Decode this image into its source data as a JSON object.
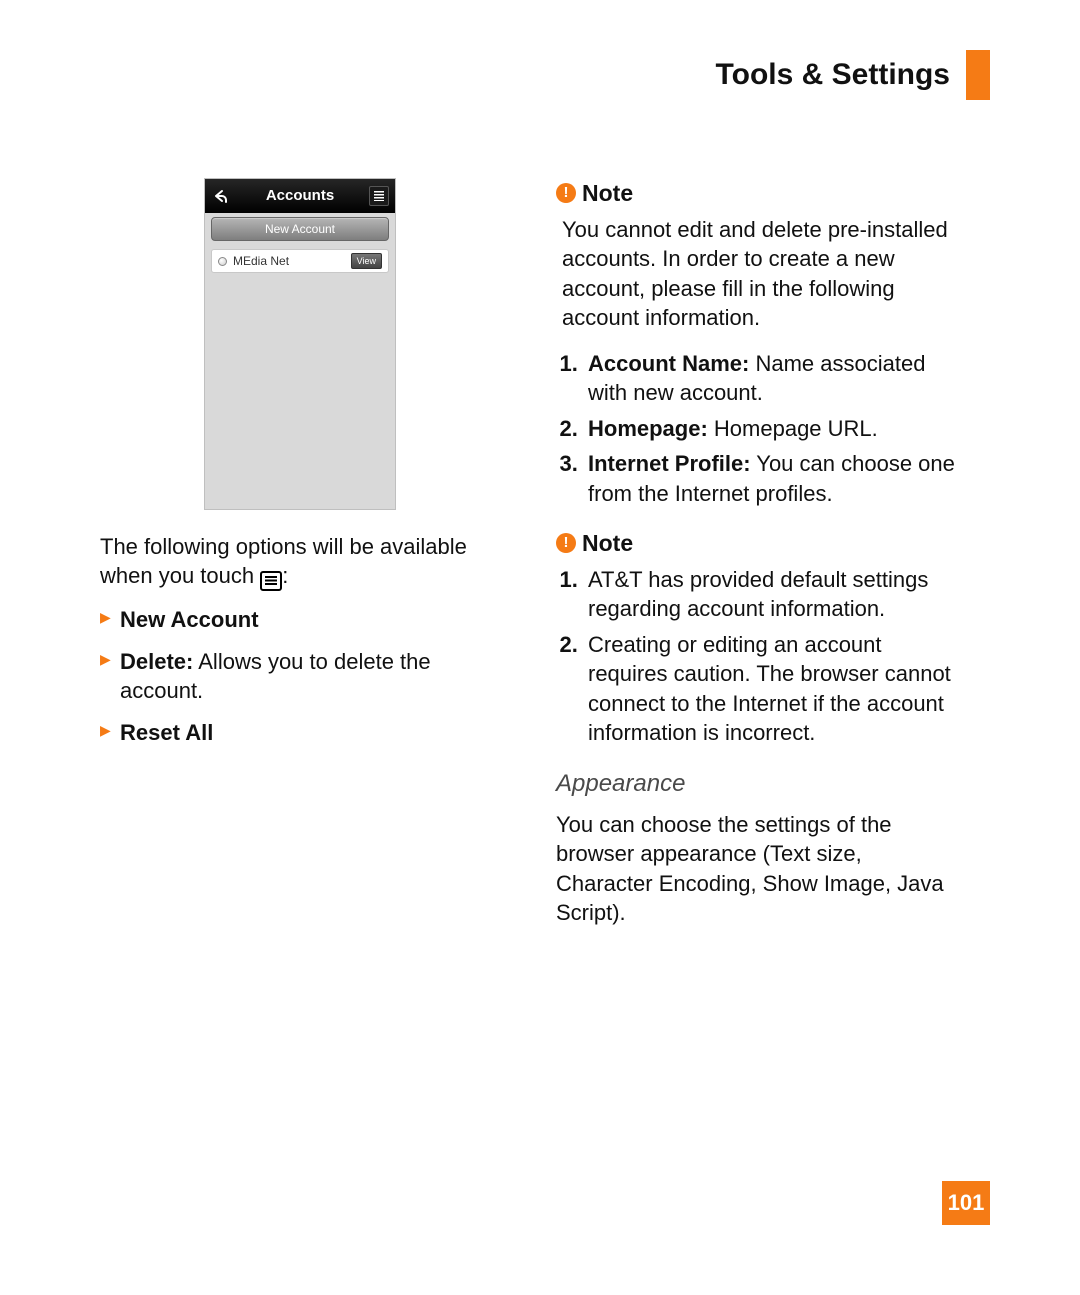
{
  "header": {
    "title": "Tools & Settings"
  },
  "phone": {
    "title": "Accounts",
    "new_account_button": "New Account",
    "item_label": "MEdia Net",
    "view_button": "View"
  },
  "left": {
    "intro_part1": "The following options will be available when you touch ",
    "intro_part2": ":",
    "options": {
      "new_account": "New Account",
      "delete_label": "Delete:",
      "delete_desc": " Allows you to delete the account.",
      "reset_all": "Reset All"
    }
  },
  "right": {
    "note1": {
      "label": "Note",
      "body": "You cannot edit and delete pre-installed accounts. In order to create a new account, please fill in the following account information.",
      "items": [
        {
          "head": "Account Name:",
          "text": " Name associated with new account."
        },
        {
          "head": "Homepage:",
          "text": " Homepage URL."
        },
        {
          "head": "Internet Profile:",
          "text": " You can choose one from the Internet profiles."
        }
      ]
    },
    "note2": {
      "label": "Note",
      "items": [
        "AT&T has provided default settings regarding account information.",
        "Creating or editing an account requires caution. The browser cannot connect to the Internet if the account information is incorrect."
      ]
    },
    "appearance": {
      "title": "Appearance",
      "body": "You can choose the settings of the browser appearance (Text size, Character Encoding, Show Image, Java Script)."
    }
  },
  "page_number": "101"
}
